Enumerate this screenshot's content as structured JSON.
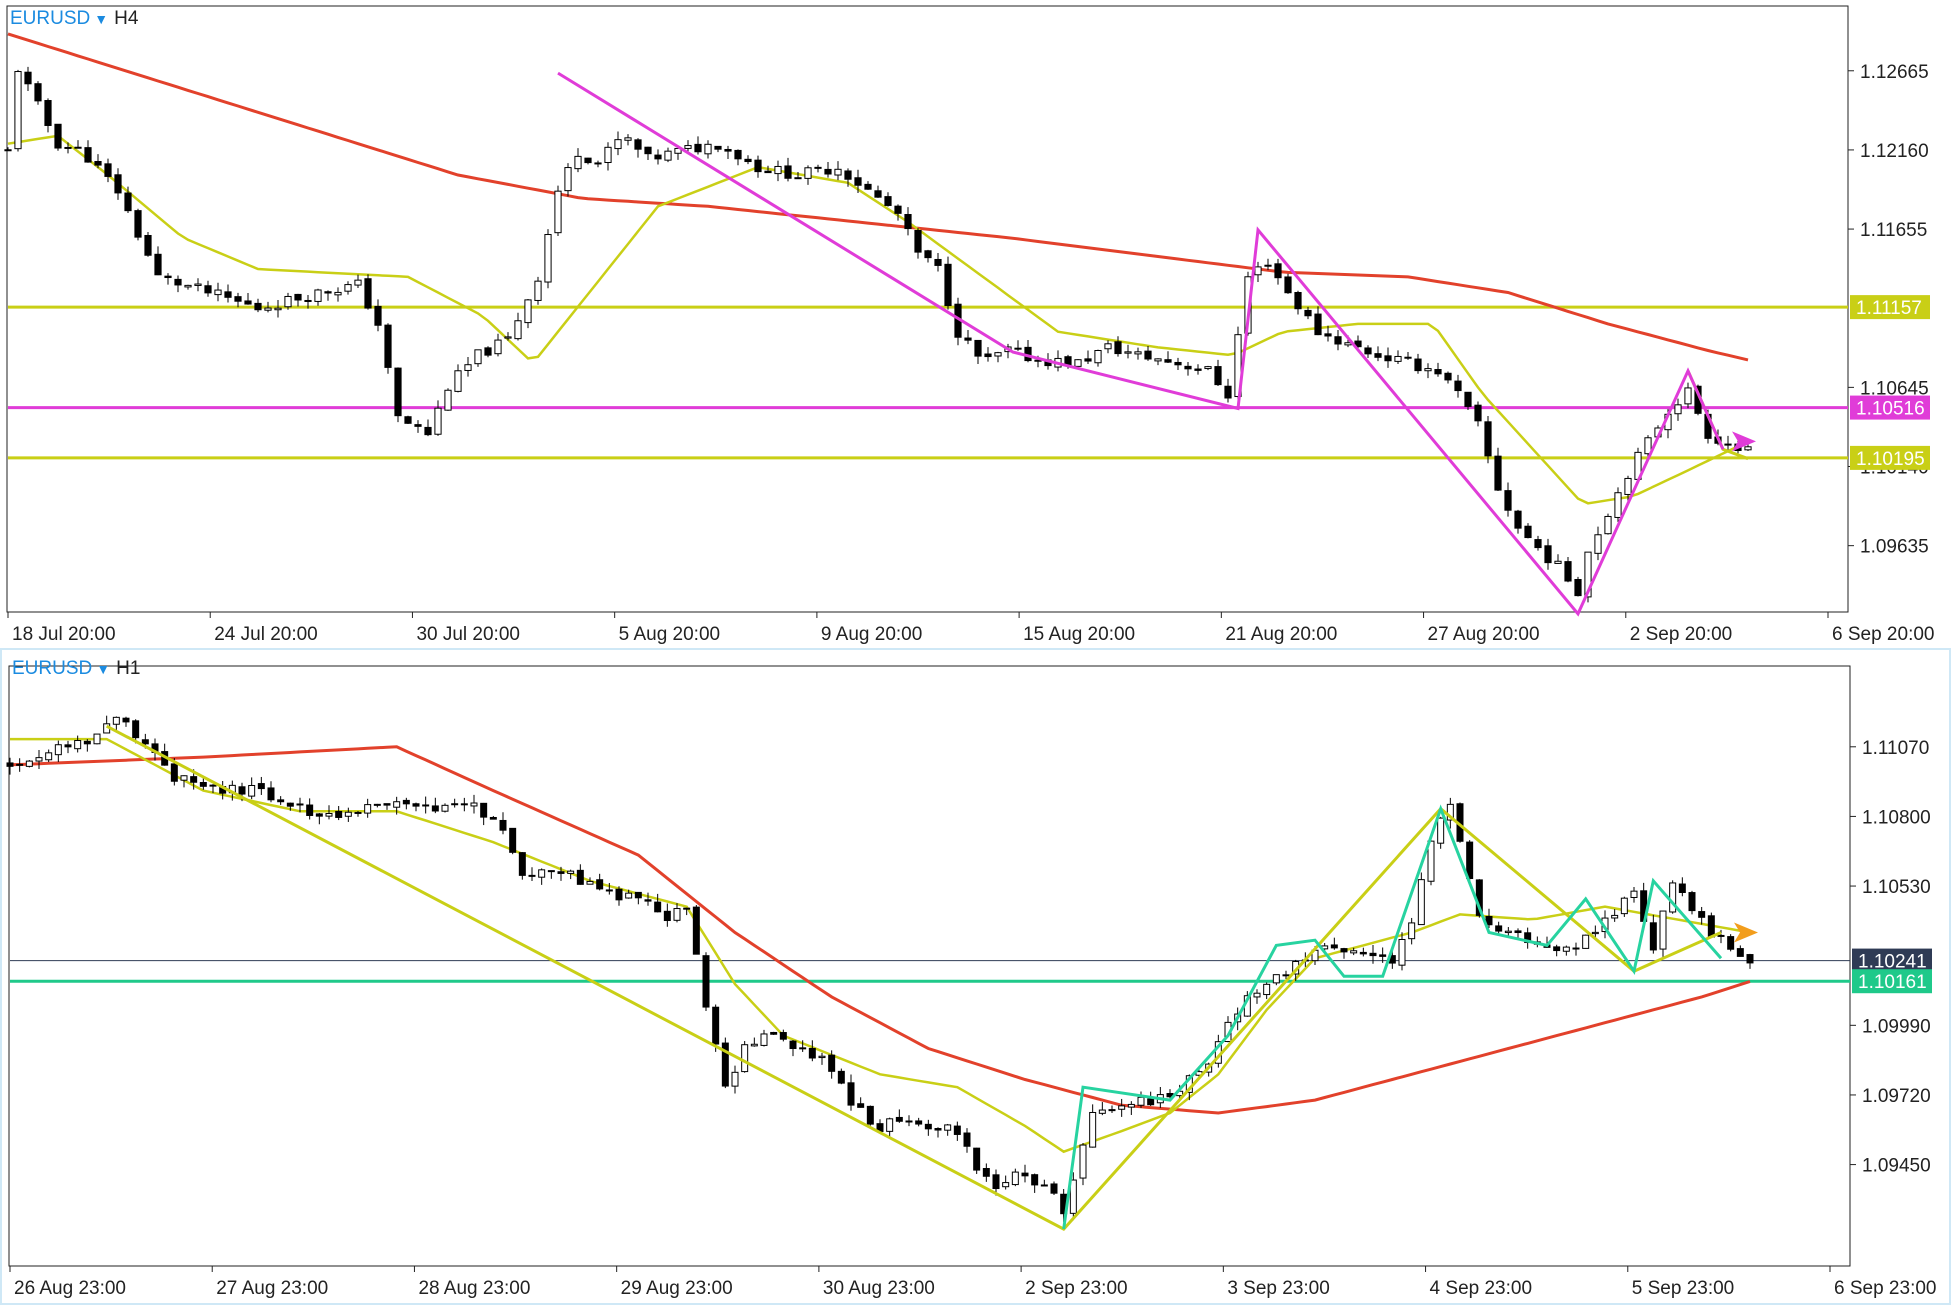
{
  "colors": {
    "bull": "#ffffff",
    "bear": "#000000",
    "ma_slow": "#e2412b",
    "ma_fast": "#c9cf16",
    "h4_level_a": "#c9cf16",
    "h4_level_b": "#e03cd8",
    "h1_level": "#1fc98a",
    "zigzag_h4": "#e03cd8",
    "zigzag_h1": "#27d3a0",
    "zigzag_h1_b": "#c9cf16",
    "price_tag": "#2f3b55",
    "arrow": "#f29d1c"
  },
  "panels": [
    {
      "id": "h4",
      "symbol": "EURUSD",
      "timeframe": "H4",
      "price_axis": [
        "1.12665",
        "1.12160",
        "1.11655",
        "1.10645",
        "1.10140",
        "1.09635"
      ],
      "time_axis": [
        "18 Jul 20:00",
        "24 Jul 20:00",
        "30 Jul 20:00",
        "5 Aug 20:00",
        "9 Aug 20:00",
        "15 Aug 20:00",
        "21 Aug 20:00",
        "27 Aug 20:00",
        "2 Sep 20:00",
        "6 Sep 20:00"
      ],
      "price_tags": [
        {
          "label": "1.11157",
          "color": "h4_level_a"
        },
        {
          "label": "1.10516",
          "color": "h4_level_b"
        },
        {
          "label": "1.10195",
          "color": "h4_level_a"
        }
      ]
    },
    {
      "id": "h1",
      "symbol": "EURUSD",
      "timeframe": "H1",
      "price_axis": [
        "1.11070",
        "1.10800",
        "1.10530",
        "1.09990",
        "1.09720",
        "1.09450"
      ],
      "time_axis": [
        "26 Aug 23:00",
        "27 Aug 23:00",
        "28 Aug 23:00",
        "29 Aug 23:00",
        "30 Aug 23:00",
        "2 Sep 23:00",
        "3 Sep 23:00",
        "4 Sep 23:00",
        "5 Sep 23:00",
        "6 Sep 23:00"
      ],
      "price_tags": [
        {
          "label": "1.10241",
          "color": "price_tag"
        },
        {
          "label": "1.10161",
          "color": "h1_level"
        }
      ]
    }
  ],
  "chart_data": [
    {
      "type": "candlestick",
      "title": "EURUSD H4",
      "y_ticks": [
        1.12665,
        1.1216,
        1.11655,
        1.10645,
        1.1014,
        1.09635
      ],
      "ylim": [
        1.0925,
        1.1304
      ],
      "x_ticks": [
        "18 Jul 20:00",
        "24 Jul 20:00",
        "30 Jul 20:00",
        "5 Aug 20:00",
        "9 Aug 20:00",
        "15 Aug 20:00",
        "21 Aug 20:00",
        "27 Aug 20:00",
        "2 Sep 20:00",
        "6 Sep 20:00"
      ],
      "horizontal_levels": [
        1.11157,
        1.10516,
        1.10195
      ],
      "current_price": 1.1023,
      "close_path": [
        [
          0,
          1.1215
        ],
        [
          2,
          1.1268
        ],
        [
          5,
          1.125
        ],
        [
          10,
          1.122
        ],
        [
          15,
          1.1215
        ],
        [
          22,
          1.119
        ],
        [
          30,
          1.1135
        ],
        [
          40,
          1.1125
        ],
        [
          50,
          1.1115
        ],
        [
          56,
          1.112
        ],
        [
          62,
          1.1125
        ],
        [
          70,
          1.113
        ],
        [
          74,
          1.1105
        ],
        [
          78,
          1.1045
        ],
        [
          84,
          1.1035
        ],
        [
          88,
          1.1065
        ],
        [
          94,
          1.1085
        ],
        [
          100,
          1.1095
        ],
        [
          106,
          1.1135
        ],
        [
          110,
          1.119
        ],
        [
          114,
          1.1215
        ],
        [
          118,
          1.1208
        ],
        [
          123,
          1.1225
        ],
        [
          128,
          1.121
        ],
        [
          134,
          1.1215
        ],
        [
          142,
          1.122
        ],
        [
          150,
          1.1205
        ],
        [
          158,
          1.12
        ],
        [
          166,
          1.1205
        ],
        [
          172,
          1.119
        ],
        [
          178,
          1.1175
        ],
        [
          182,
          1.115
        ],
        [
          186,
          1.114
        ],
        [
          190,
          1.11
        ],
        [
          195,
          1.108
        ],
        [
          200,
          1.1088
        ],
        [
          206,
          1.1082
        ],
        [
          214,
          1.108
        ],
        [
          220,
          1.109
        ],
        [
          226,
          1.1085
        ],
        [
          234,
          1.108
        ],
        [
          240,
          1.1075
        ],
        [
          244,
          1.106
        ],
        [
          248,
          1.1135
        ],
        [
          252,
          1.1145
        ],
        [
          256,
          1.1125
        ],
        [
          262,
          1.11
        ],
        [
          268,
          1.1092
        ],
        [
          274,
          1.1085
        ],
        [
          280,
          1.108
        ],
        [
          286,
          1.1075
        ],
        [
          290,
          1.106
        ],
        [
          294,
          1.104
        ],
        [
          298,
          1.1
        ],
        [
          302,
          1.0975
        ],
        [
          306,
          1.0962
        ],
        [
          310,
          1.095
        ],
        [
          314,
          1.0935
        ],
        [
          316,
          1.096
        ],
        [
          320,
          1.0985
        ],
        [
          324,
          1.101
        ],
        [
          328,
          1.103
        ],
        [
          332,
          1.105
        ],
        [
          336,
          1.1062
        ],
        [
          340,
          1.1035
        ],
        [
          344,
          1.1028
        ],
        [
          348,
          1.1023
        ]
      ],
      "ma_slow": [
        [
          0,
          1.129
        ],
        [
          30,
          1.126
        ],
        [
          60,
          1.123
        ],
        [
          90,
          1.12
        ],
        [
          115,
          1.1185
        ],
        [
          140,
          1.118
        ],
        [
          170,
          1.117
        ],
        [
          200,
          1.116
        ],
        [
          230,
          1.1148
        ],
        [
          255,
          1.1138
        ],
        [
          280,
          1.1135
        ],
        [
          300,
          1.1125
        ],
        [
          320,
          1.1105
        ],
        [
          340,
          1.1088
        ],
        [
          348,
          1.1082
        ]
      ],
      "ma_fast": [
        [
          0,
          1.122
        ],
        [
          10,
          1.1225
        ],
        [
          20,
          1.12
        ],
        [
          35,
          1.116
        ],
        [
          50,
          1.114
        ],
        [
          62,
          1.1138
        ],
        [
          80,
          1.1135
        ],
        [
          95,
          1.111
        ],
        [
          105,
          1.108
        ],
        [
          115,
          1.112
        ],
        [
          130,
          1.118
        ],
        [
          150,
          1.1205
        ],
        [
          168,
          1.1195
        ],
        [
          180,
          1.117
        ],
        [
          195,
          1.1135
        ],
        [
          210,
          1.11
        ],
        [
          230,
          1.109
        ],
        [
          245,
          1.1085
        ],
        [
          255,
          1.11
        ],
        [
          270,
          1.1105
        ],
        [
          285,
          1.1105
        ],
        [
          295,
          1.106
        ],
        [
          305,
          1.1025
        ],
        [
          315,
          1.099
        ],
        [
          325,
          1.0995
        ],
        [
          335,
          1.101
        ],
        [
          348,
          1.103
        ]
      ],
      "zigzag": [
        [
          110,
          1.1265
        ],
        [
          201,
          1.1087
        ],
        [
          246,
          1.1051
        ],
        [
          250,
          1.1165
        ],
        [
          314,
          1.092
        ],
        [
          336,
          1.1075
        ],
        [
          343,
          1.1025
        ]
      ],
      "zigzag_b": [
        [
          336,
          1.1075
        ],
        [
          343,
          1.1025
        ],
        [
          348,
          1.1019
        ]
      ]
    },
    {
      "type": "candlestick",
      "title": "EURUSD H1",
      "y_ticks": [
        1.1107,
        1.108,
        1.1053,
        1.0999,
        1.0972,
        1.0945
      ],
      "ylim": [
        1.0908,
        1.1136
      ],
      "x_ticks": [
        "26 Aug 23:00",
        "27 Aug 23:00",
        "28 Aug 23:00",
        "29 Aug 23:00",
        "30 Aug 23:00",
        "2 Sep 23:00",
        "3 Sep 23:00",
        "4 Sep 23:00",
        "5 Sep 23:00",
        "6 Sep 23:00"
      ],
      "horizontal_levels": [
        1.10241,
        1.10161
      ],
      "current_price": 1.10241,
      "close_path": [
        [
          0,
          1.11
        ],
        [
          8,
          1.1105
        ],
        [
          16,
          1.111
        ],
        [
          22,
          1.1118
        ],
        [
          28,
          1.111
        ],
        [
          34,
          1.1095
        ],
        [
          42,
          1.109
        ],
        [
          50,
          1.109
        ],
        [
          58,
          1.1085
        ],
        [
          64,
          1.108
        ],
        [
          70,
          1.1082
        ],
        [
          78,
          1.1085
        ],
        [
          88,
          1.1082
        ],
        [
          96,
          1.1085
        ],
        [
          102,
          1.1075
        ],
        [
          106,
          1.1058
        ],
        [
          112,
          1.106
        ],
        [
          118,
          1.1055
        ],
        [
          124,
          1.105
        ],
        [
          130,
          1.1048
        ],
        [
          136,
          1.104
        ],
        [
          140,
          1.1045
        ],
        [
          144,
          1.1005
        ],
        [
          146,
          1.099
        ],
        [
          148,
          1.0975
        ],
        [
          152,
          1.099
        ],
        [
          156,
          1.0995
        ],
        [
          162,
          1.0992
        ],
        [
          168,
          1.0985
        ],
        [
          172,
          1.0975
        ],
        [
          176,
          1.0965
        ],
        [
          180,
          1.096
        ],
        [
          186,
          1.0962
        ],
        [
          192,
          1.096
        ],
        [
          196,
          1.0958
        ],
        [
          200,
          1.0945
        ],
        [
          204,
          1.0935
        ],
        [
          208,
          1.094
        ],
        [
          212,
          1.0938
        ],
        [
          216,
          1.0932
        ],
        [
          218,
          1.0925
        ],
        [
          220,
          1.094
        ],
        [
          224,
          1.0965
        ],
        [
          230,
          1.0968
        ],
        [
          236,
          1.097
        ],
        [
          242,
          1.0975
        ],
        [
          248,
          1.0985
        ],
        [
          252,
          1.1
        ],
        [
          256,
          1.101
        ],
        [
          262,
          1.1018
        ],
        [
          268,
          1.1025
        ],
        [
          274,
          1.103
        ],
        [
          280,
          1.1028
        ],
        [
          286,
          1.1022
        ],
        [
          290,
          1.104
        ],
        [
          294,
          1.107
        ],
        [
          298,
          1.1085
        ],
        [
          300,
          1.107
        ],
        [
          304,
          1.104
        ],
        [
          310,
          1.1035
        ],
        [
          318,
          1.103
        ],
        [
          324,
          1.1028
        ],
        [
          330,
          1.104
        ],
        [
          336,
          1.105
        ],
        [
          340,
          1.103
        ],
        [
          344,
          1.1055
        ],
        [
          348,
          1.1045
        ],
        [
          352,
          1.1035
        ],
        [
          356,
          1.103
        ],
        [
          360,
          1.1024
        ]
      ],
      "ma_slow": [
        [
          0,
          1.11
        ],
        [
          40,
          1.1103
        ],
        [
          80,
          1.1107
        ],
        [
          100,
          1.109
        ],
        [
          130,
          1.1065
        ],
        [
          150,
          1.1035
        ],
        [
          170,
          1.101
        ],
        [
          190,
          1.099
        ],
        [
          210,
          1.0978
        ],
        [
          230,
          1.0968
        ],
        [
          250,
          1.0965
        ],
        [
          270,
          1.097
        ],
        [
          290,
          1.098
        ],
        [
          310,
          1.099
        ],
        [
          330,
          1.1
        ],
        [
          350,
          1.101
        ],
        [
          360,
          1.1016
        ]
      ],
      "ma_fast": [
        [
          0,
          1.111
        ],
        [
          20,
          1.111
        ],
        [
          40,
          1.109
        ],
        [
          60,
          1.1082
        ],
        [
          80,
          1.1082
        ],
        [
          100,
          1.107
        ],
        [
          120,
          1.1055
        ],
        [
          140,
          1.1045
        ],
        [
          150,
          1.1015
        ],
        [
          160,
          1.0995
        ],
        [
          180,
          1.098
        ],
        [
          196,
          1.0975
        ],
        [
          210,
          1.096
        ],
        [
          218,
          1.095
        ],
        [
          230,
          1.0958
        ],
        [
          240,
          1.0965
        ],
        [
          250,
          1.098
        ],
        [
          260,
          1.1005
        ],
        [
          270,
          1.1025
        ],
        [
          280,
          1.103
        ],
        [
          290,
          1.1035
        ],
        [
          300,
          1.1042
        ],
        [
          315,
          1.104
        ],
        [
          330,
          1.1045
        ],
        [
          345,
          1.104
        ],
        [
          360,
          1.1035
        ]
      ],
      "zigzag": [
        [
          218,
          1.092
        ],
        [
          222,
          1.0975
        ],
        [
          240,
          1.097
        ],
        [
          252,
          1.0995
        ],
        [
          262,
          1.103
        ],
        [
          270,
          1.1032
        ],
        [
          276,
          1.1018
        ],
        [
          284,
          1.1018
        ],
        [
          296,
          1.1083
        ],
        [
          306,
          1.1035
        ],
        [
          318,
          1.103
        ],
        [
          326,
          1.1048
        ],
        [
          336,
          1.102
        ],
        [
          340,
          1.1055
        ],
        [
          354,
          1.1025
        ]
      ],
      "zigzag_b": [
        [
          20,
          1.1115
        ],
        [
          218,
          1.092
        ],
        [
          296,
          1.1083
        ],
        [
          336,
          1.102
        ],
        [
          354,
          1.1035
        ]
      ]
    }
  ]
}
